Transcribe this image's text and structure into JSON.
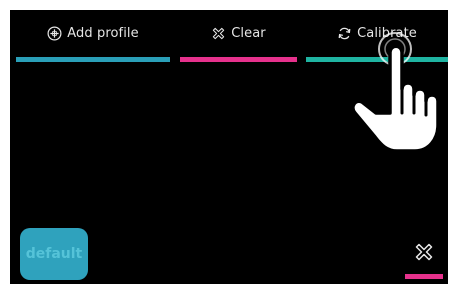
{
  "toolbar": {
    "add_profile": {
      "label": "Add profile",
      "icon": "plus-circle-icon",
      "accent": "#2a9fb8"
    },
    "clear": {
      "label": "Clear",
      "icon": "x-outline-icon",
      "accent": "#e6318c"
    },
    "calibrate": {
      "label": "Calibrate",
      "icon": "refresh-icon",
      "accent": "#1fb4a2"
    }
  },
  "default_button": {
    "label": "default",
    "bg": "#2fa2bd",
    "text_color": "#55c3d8"
  },
  "close": {
    "icon": "close-icon",
    "accent": "#e6318c"
  },
  "overlay": {
    "icon": "pointing-hand-icon"
  }
}
